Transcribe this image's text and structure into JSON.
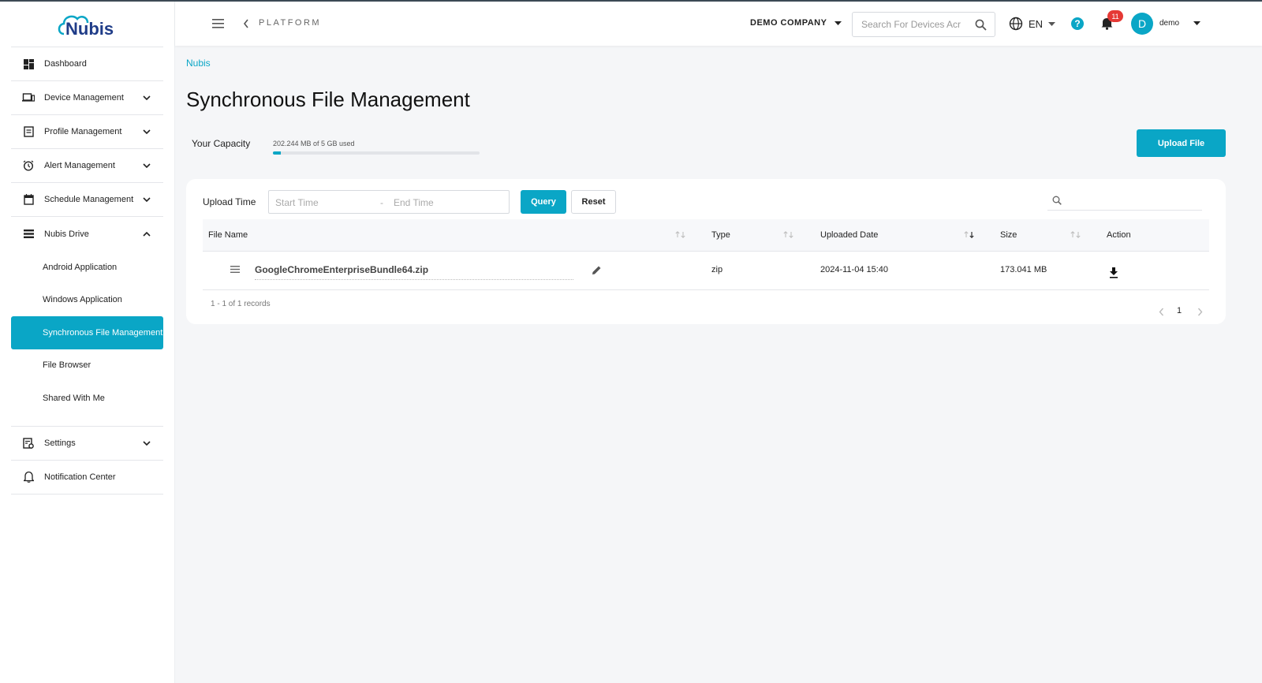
{
  "brand": {
    "logo_text": "Nubis",
    "accent": "#0aa6c6"
  },
  "sidebar": {
    "items": [
      {
        "label": "Dashboard",
        "icon": "dashboard-icon"
      },
      {
        "label": "Device Management",
        "icon": "devices-icon"
      },
      {
        "label": "Profile Management",
        "icon": "profile-icon"
      },
      {
        "label": "Alert Management",
        "icon": "alarm-icon"
      },
      {
        "label": "Schedule Management",
        "icon": "calendar-icon"
      },
      {
        "label": "Nubis Drive",
        "icon": "drive-icon"
      }
    ],
    "drive_sub": [
      {
        "label": "Android Application"
      },
      {
        "label": "Windows Application"
      },
      {
        "label": "Synchronous File Management"
      },
      {
        "label": "File Browser"
      },
      {
        "label": "Shared With Me"
      }
    ],
    "bottom": [
      {
        "label": "Settings",
        "icon": "settings-icon"
      },
      {
        "label": "Notification Center",
        "icon": "bell-outline-icon"
      }
    ]
  },
  "header": {
    "platform": "PLATFORM",
    "company": "DEMO COMPANY",
    "search_placeholder": "Search For Devices Acr",
    "language": "EN",
    "notification_count": "11",
    "avatar_letter": "D",
    "username": "demo"
  },
  "page": {
    "breadcrumb": "Nubis",
    "title": "Synchronous File Management",
    "capacity_label": "Your Capacity",
    "capacity_text": "202.244 MB of 5 GB used",
    "capacity_used_fraction": 0.04,
    "upload_button": "Upload File"
  },
  "filter": {
    "label": "Upload Time",
    "start_placeholder": "Start Time",
    "separator": "-",
    "end_placeholder": "End Time",
    "query": "Query",
    "reset": "Reset"
  },
  "table": {
    "columns": [
      "File Name",
      "Type",
      "Uploaded Date",
      "Size",
      "Action"
    ],
    "rows": [
      {
        "name": "GoogleChromeEnterpriseBundle64.zip",
        "type": "zip",
        "date": "2024-11-04 15:40",
        "size": "173.041 MB"
      }
    ],
    "records": "1 - 1 of 1 records",
    "page": "1"
  }
}
